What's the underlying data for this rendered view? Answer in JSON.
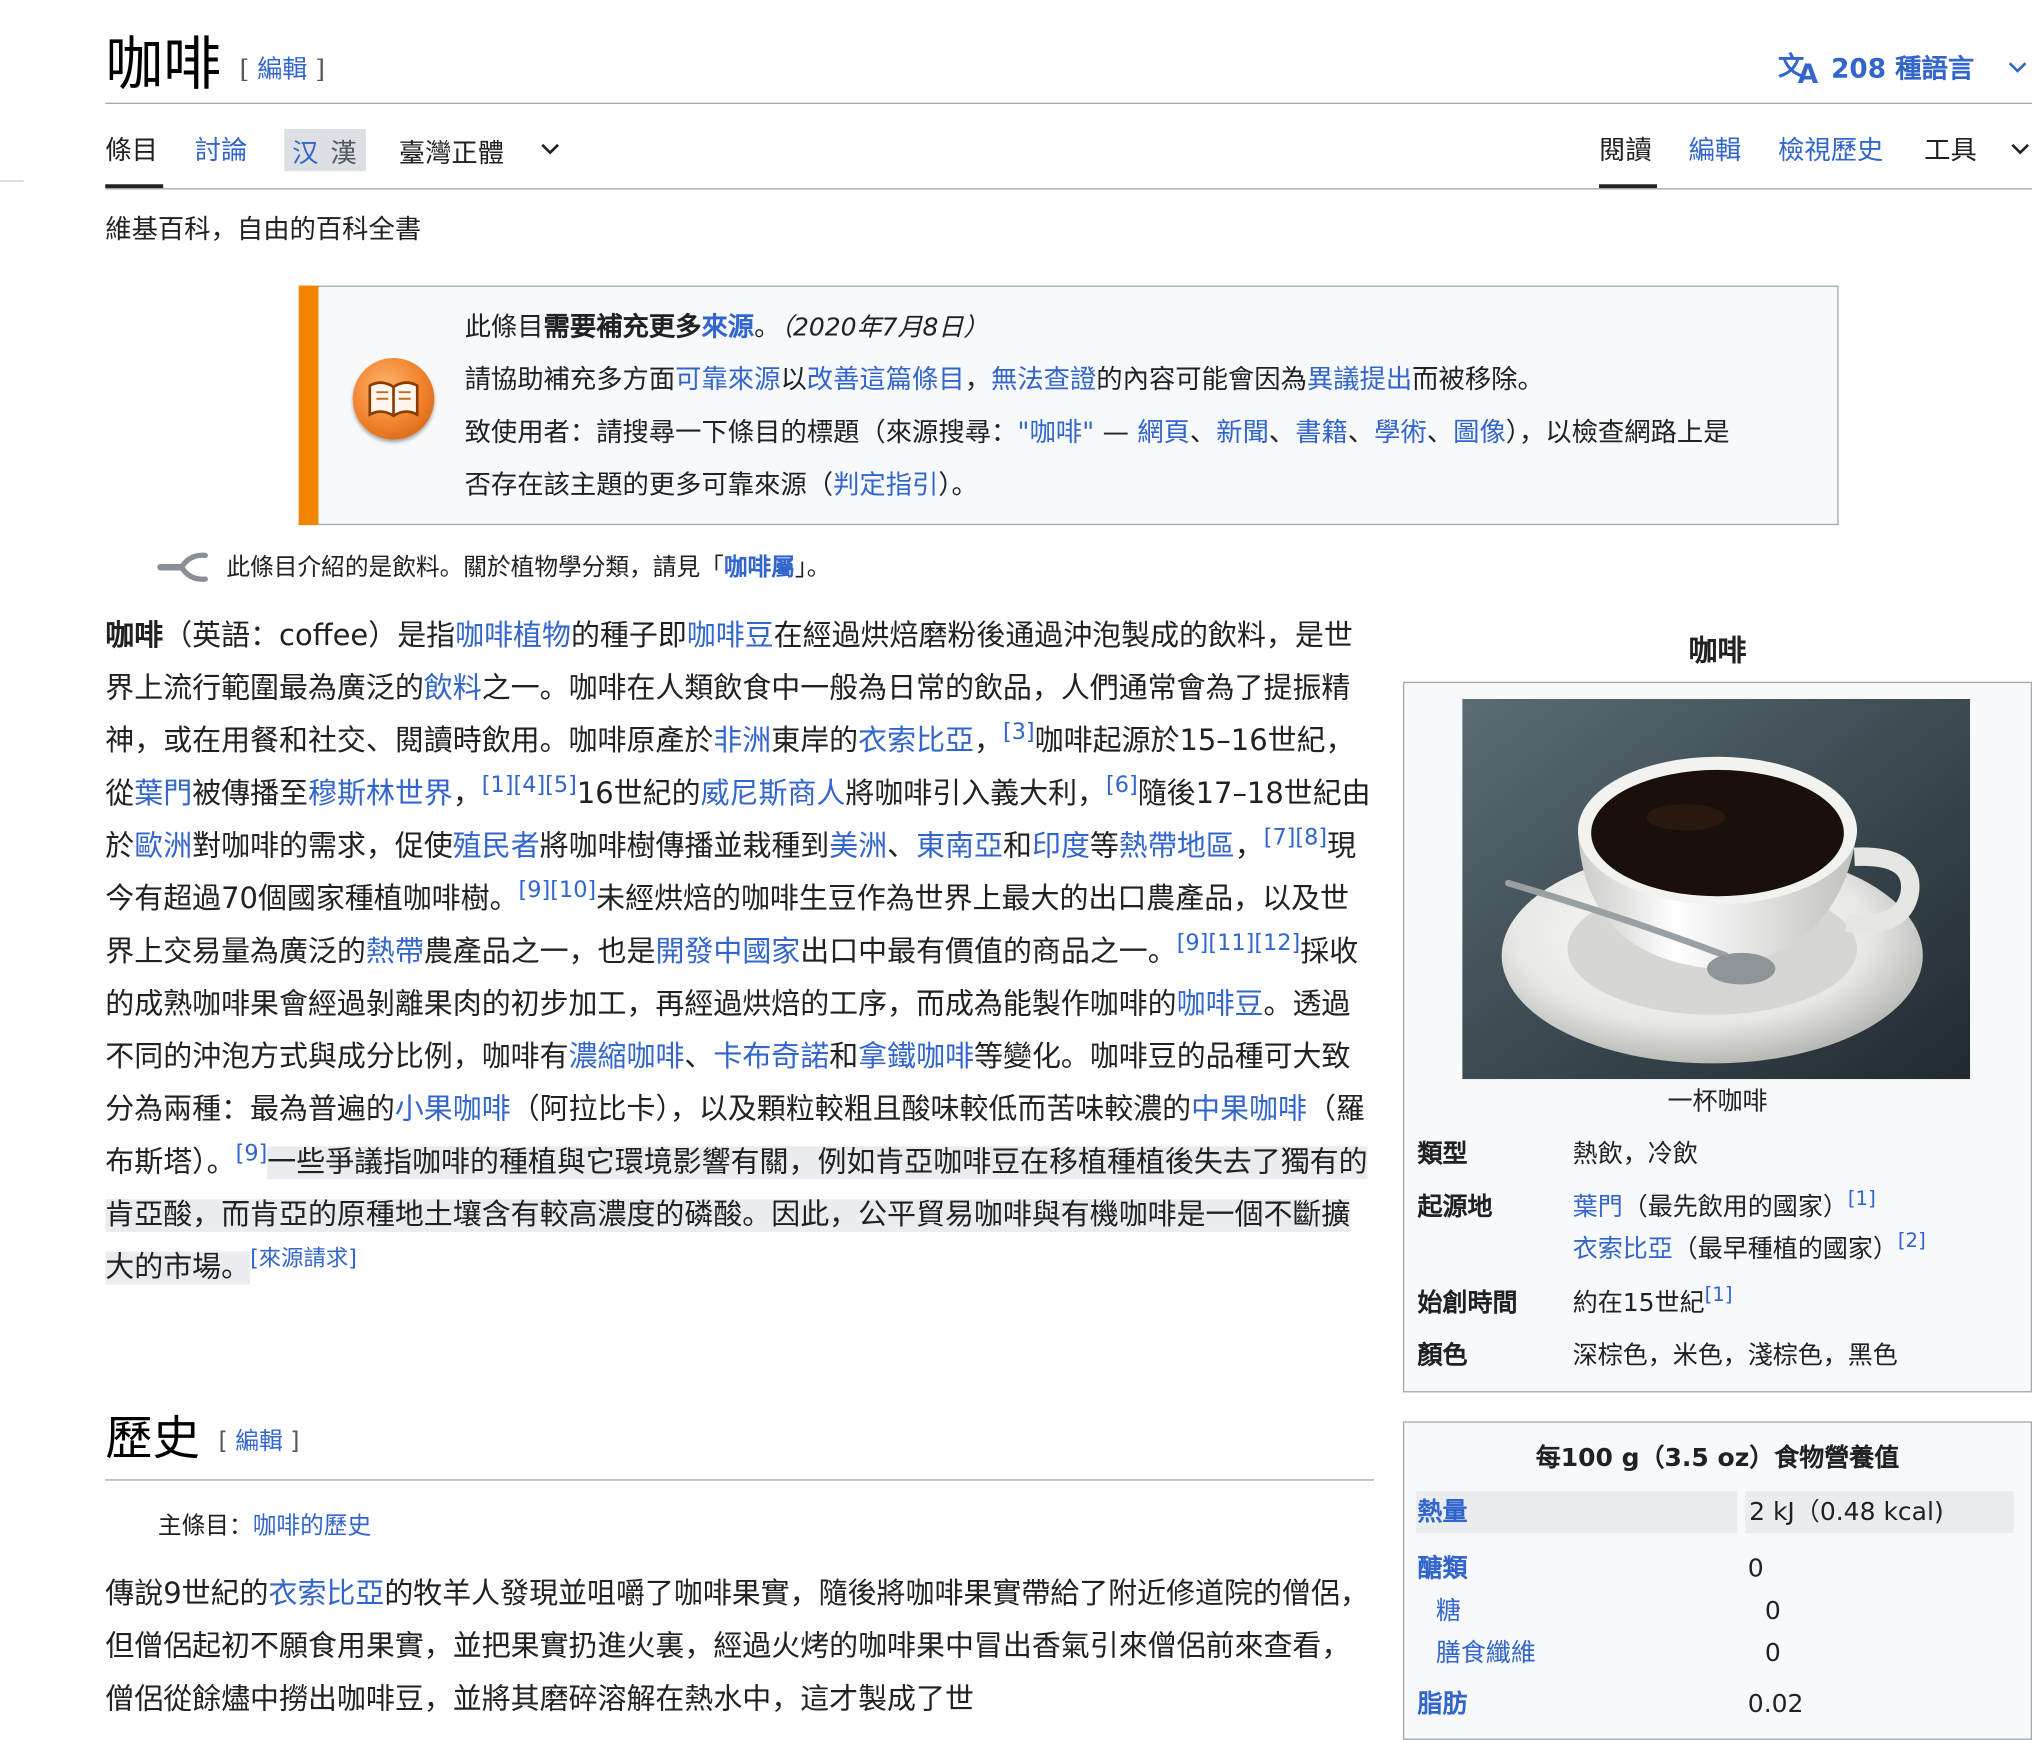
{
  "page": {
    "title": "咖啡",
    "edit_open": "[",
    "edit_label": "編輯",
    "edit_close": "]",
    "languages": "208 種語言"
  },
  "tabs": {
    "article": "條目",
    "talk": "討論",
    "variant_simplified": "汉",
    "variant_traditional": "漢",
    "variant_selected": "臺灣正體",
    "read": "閱讀",
    "edit": "編輯",
    "history": "檢視歷史",
    "tools": "工具"
  },
  "tagline": "維基百科，自由的百科全書",
  "ambox": {
    "l1_a": "此條目",
    "l1_b": "需要補充更多",
    "l1_link": "來源",
    "l1_c": "。",
    "l1_date": "（2020年7月8日）",
    "l2_a": "請協助補充多方面",
    "l2_link1": "可靠來源",
    "l2_b": "以",
    "l2_link2": "改善這篇條目",
    "l2_c": "，",
    "l2_link3": "無法查證",
    "l2_d": "的內容可能會因為",
    "l2_link4": "異議提出",
    "l2_e": "而被移除。",
    "l3_a": "致使用者：請搜尋一下條目的標題（來源搜尋：",
    "l3_query": "\"咖啡\"",
    "l3_dash": " — ",
    "l3_s1": "網頁",
    "l3_s2": "新聞",
    "l3_s3": "書籍",
    "l3_s4": "學術",
    "l3_s5": "圖像",
    "l3_sep": "、",
    "l3_b": "），以檢查網路上是",
    "l4_a": "否存在該主題的更多可靠來源（",
    "l4_link": "判定指引",
    "l4_b": "）。"
  },
  "hatnote": {
    "text": "此條目介紹的是飲料。關於植物學分類，請見「",
    "link": "咖啡屬",
    "end": "」。"
  },
  "para1": {
    "t0": "咖啡",
    "t1": "（英語：coffee）是指",
    "l1": "咖啡植物",
    "t2": "的種子即",
    "l2": "咖啡豆",
    "t3": "在經過烘焙磨粉後通過沖泡製成的飲料，是世界上流行範圍最為廣泛的",
    "l3": "飲料",
    "t4": "之一。咖啡在人類飲食中一般為日常的飲品，人們通常會為了提振精神，或在用餐和社交、閱讀時飲用。咖啡原產於",
    "l4": "非洲",
    "t5": "東岸的",
    "l5": "衣索比亞",
    "t6": "，",
    "r1": "[3]",
    "t7": "咖啡起源於15–16世紀，從",
    "l6": "葉門",
    "t8": "被傳播至",
    "l7": "穆斯林世界",
    "t9": "，",
    "r2": "[1][4][5]",
    "t10": "16世紀的",
    "l8": "威尼斯商人",
    "t11": "將咖啡引入義大利，",
    "r3": "[6]",
    "t12": "隨後17–18世紀由於",
    "l9": "歐洲",
    "t13": "對咖啡的需求，促使",
    "l10": "殖民者",
    "t14": "將咖啡樹傳播並栽種到",
    "l11": "美洲",
    "t15": "、",
    "l12": "東南亞",
    "t16": "和",
    "l13": "印度",
    "t17": "等",
    "l14": "熱帶地區",
    "t18": "，",
    "r4": "[7][8]",
    "t19": "現今有超過70個國家種植咖啡樹。",
    "r5": "[9][10]",
    "t20": "未經烘焙的咖啡生豆作為世界上最大的出口農產品，以及世界上交易量為廣泛的",
    "l15": "熱帶",
    "t21": "農產品之一，也是",
    "l16": "開發中國家",
    "t22": "出口中最有價值的商品之一。",
    "r6": "[9][11][12]",
    "t23": "採收的成熟咖啡果會經過剝離果肉的初步加工，再經過烘焙的工序，而成為能製作咖啡的",
    "l17": "咖啡豆",
    "t24": "。透過不同的沖泡方式與成分比例，咖啡有",
    "l18": "濃縮咖啡",
    "t25": "、",
    "l19": "卡布奇諾",
    "t26": "和",
    "l20": "拿鐵咖啡",
    "t27": "等變化。咖啡豆的品種可大致分為兩種：最為普遍的",
    "l21": "小果咖啡",
    "t28": "（阿拉比卡），以及顆粒較粗且酸味較低而苦味較濃的",
    "l22": "中果咖啡",
    "t29": "（羅布斯塔）。",
    "r7": "[9]",
    "h1": "一些爭議指咖啡的種植與它環境影響有關，例如肯亞咖啡豆在移植種植後失去了獨有的肯亞酸，而肯亞的原種地土壤含有較高濃度的磷酸。因此，公平貿易咖啡與有機咖啡是一個不斷擴大的市場。",
    "r8": "[來源請求]"
  },
  "history": {
    "heading": "歷史",
    "edit_label": "編輯",
    "main_label": "主條目：",
    "main_link": "咖啡的歷史",
    "t1": "傳說9世紀的",
    "l1": "衣索比亞",
    "t2": "的牧羊人發現並咀嚼了咖啡果實，隨後將咖啡果實帶給了附近修道院的僧侶，但僧侶起初不願食用果實，並把果實扔進火裏，經過火烤的咖啡果中冒出香氣引來僧侶前來查看，僧侶從餘燼中撈出咖啡豆，並將其磨碎溶解在熱水中，這才製成了世"
  },
  "infobox": {
    "title": "咖啡",
    "caption": "一杯咖啡",
    "type_label": "類型",
    "type_value": "熱飲，冷飲",
    "origin_label": "起源地",
    "origin_1_link": "葉門",
    "origin_1_text": "（最先飲用的國家）",
    "origin_1_ref": "[1]",
    "origin_2_link": "衣索比亞",
    "origin_2_text": "（最早種植的國家）",
    "origin_2_ref": "[2]",
    "start_label": "始創時間",
    "start_value": "約在15世紀",
    "start_ref": "[1]",
    "color_label": "顏色",
    "color_value": "深棕色，米色，淺棕色，黑色"
  },
  "nutrition": {
    "title": "每100 g（3.5 oz）食物營養值",
    "energy_label": "熱量",
    "energy_value": "2 kJ（0.48 kcal)",
    "carb_label": "醣類",
    "carb_value": "0",
    "sugar_label": "糖",
    "sugar_value": "0",
    "fiber_label": "膳食纖維",
    "fiber_value": "0",
    "fat_label": "脂肪",
    "fat_value": "0.02"
  },
  "colors": {
    "link": "#3366cc",
    "ambox_bar": "#f28500",
    "text": "#202122"
  }
}
